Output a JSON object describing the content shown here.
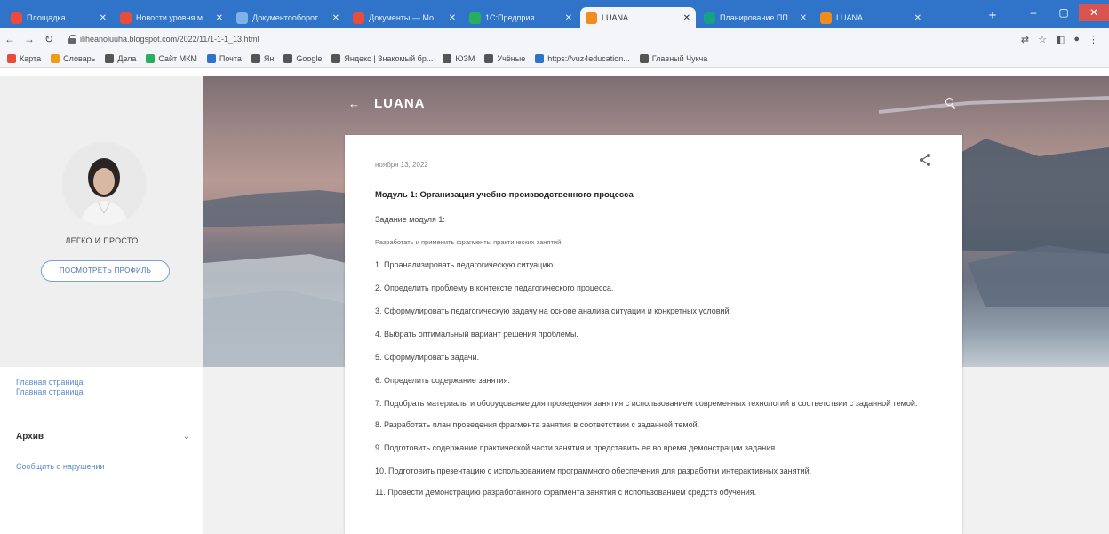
{
  "browser": {
    "tabs": [
      {
        "label": "Площадка",
        "favicon_color": "#e74c3c"
      },
      {
        "label": "Новости уровня мас...",
        "favicon_color": "#e74c3c"
      },
      {
        "label": "Документооборот О...",
        "favicon_color": "#7fb2e8"
      },
      {
        "label": "Документы — Мои...",
        "favicon_color": "#e74c3c"
      },
      {
        "label": "1С:Предприя...",
        "favicon_color": "#27ae60"
      },
      {
        "label": "LUANA",
        "favicon_color": "#f08c1e",
        "active": true
      },
      {
        "label": "Планирование ПП...",
        "favicon_color": "#16a085"
      },
      {
        "label": "LUANA",
        "favicon_color": "#f08c1e"
      }
    ],
    "url": "iliheanoluuha.blogspot.com/2022/11/1-1-1_13.html",
    "bookmarks": [
      {
        "label": "Карта",
        "color": "#e74c3c"
      },
      {
        "label": "Словарь",
        "color": "#f39c12"
      },
      {
        "label": "Дела",
        "color": "#555555"
      },
      {
        "label": "Сайт МКМ",
        "color": "#27ae60"
      },
      {
        "label": "Почта",
        "color": "#2f74c9"
      },
      {
        "label": "Ян",
        "color": "#555555"
      },
      {
        "label": "Google",
        "color": "#555555"
      },
      {
        "label": "Яндекс | Знакомый бр...",
        "color": "#555555"
      },
      {
        "label": "ЮЗМ",
        "color": "#555555"
      },
      {
        "label": "Учёные",
        "color": "#555555"
      },
      {
        "label": "https://vuz4education...",
        "color": "#2f74c9"
      },
      {
        "label": "Главный Чукча",
        "color": "#555555"
      }
    ]
  },
  "blog": {
    "title": "LUANA",
    "profile_name": "ЛЕГКО И ПРОСТО",
    "profile_button": "ПОСМОТРЕТЬ ПРОФИЛЬ",
    "sidebar_links": [
      "Главная страница",
      "Главная страница"
    ],
    "archive_label": "Архив",
    "report_link": "Сообщить о нарушении"
  },
  "post": {
    "date": "ноября 13, 2022",
    "title": "Модуль 1: Организация учебно-производственного процесса",
    "subtitle": "Задание модуля 1:",
    "note": "Разработать и применить фрагменты практических занятий",
    "items": [
      "1. Проанализировать педагогическую ситуацию.",
      "2. Определить проблему в контексте педагогического процесса.",
      "3. Сформулировать педагогическую задачу на основе анализа ситуации и конкретных условий.",
      "4. Выбрать оптимальный вариант решения проблемы.",
      "5. Сформулировать задачи.",
      "6. Определить содержание занятия.",
      "7. Подобрать материалы и оборудование для проведения занятия с использованием современных технологий в соответствии с заданной темой.",
      "8. Разработать план проведения фрагмента занятия в соответствии с заданной темой.",
      "9. Подготовить содержание практической части занятия и представить ее во время демонстрации задания.",
      "10. Подготовить презентацию с использованием программного обеспечения для разработки интерактивных занятий.",
      "11. Провести демонстрацию разработанного фрагмента занятия с использованием средств обучения."
    ]
  }
}
